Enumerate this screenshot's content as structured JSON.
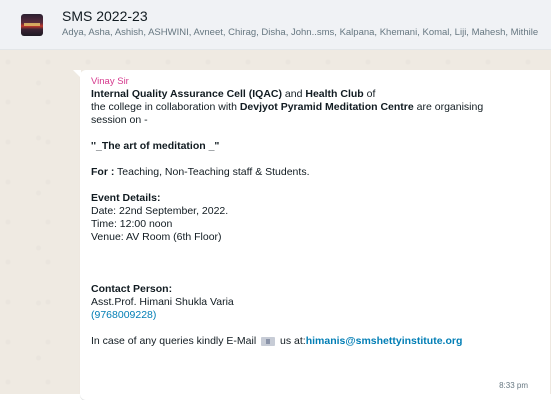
{
  "chat": {
    "title": "SMS 2022-23",
    "members": "Adya, Asha, Ashish, ASHWINI, Avneet, Chirag, Disha, John..sms, Kalpana, Khemani, Komal, Liji, Mahesh, Mithile"
  },
  "message": {
    "sender": "Vinay Sir",
    "line1_part1": "Internal Quality Assurance Cell  (IQAC)",
    "line1_part2": " and ",
    "line1_part3": "Health Club",
    "line1_part4": " of",
    "line2_part1": "the college in collaboration with ",
    "line2_part2": "Devjyot Pyramid Meditation Centre",
    "line2_part3": " are organising",
    "line3": "session on -",
    "event_title": "''_The art of meditation _\"",
    "for_label": "For :",
    "for_value": " Teaching, Non-Teaching staff & Students.",
    "details_heading": "Event Details:",
    "date": "Date: 22nd September, 2022.",
    "time": "Time: 12:00 noon",
    "venue": "Venue: AV Room (6th Floor)",
    "contact_heading": "Contact Person:",
    "contact_name": "Asst.Prof. Himani Shukla Varia",
    "contact_phone": "(9768009228)",
    "query_part1": "In case of any queries kindly E-Mail",
    "query_part2": " us at:",
    "email": "himanis@smshettyinstitute.org",
    "timestamp": "8:33 pm"
  }
}
